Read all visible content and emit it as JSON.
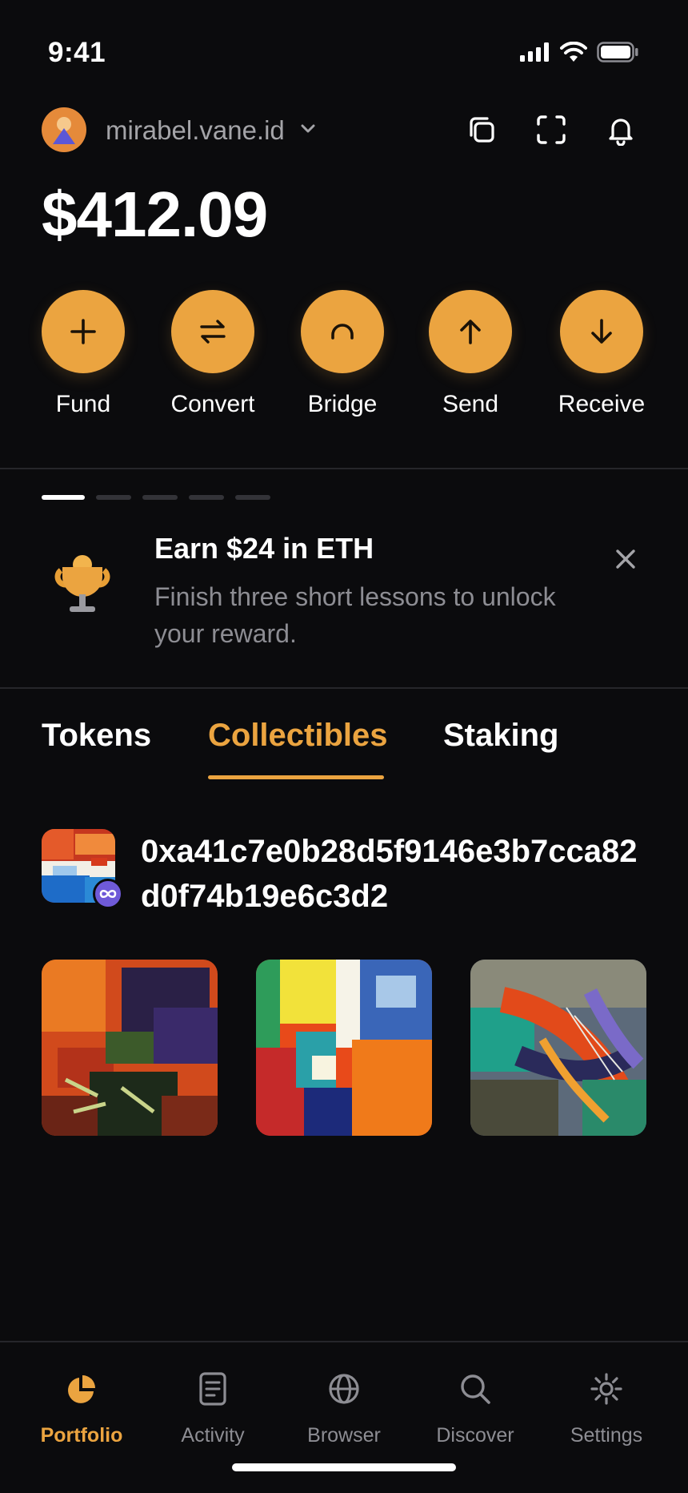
{
  "status_bar": {
    "time": "9:41",
    "icons": [
      "signal-icon",
      "wifi-icon",
      "battery-icon"
    ]
  },
  "header": {
    "account_name": "mirabel.vane.id",
    "icons": [
      "copy-icon",
      "scan-icon",
      "bell-icon"
    ]
  },
  "balance": "$412.09",
  "actions": [
    {
      "label": "Fund",
      "icon": "plus-icon"
    },
    {
      "label": "Convert",
      "icon": "swap-icon"
    },
    {
      "label": "Bridge",
      "icon": "bridge-icon"
    },
    {
      "label": "Send",
      "icon": "arrow-up-icon"
    },
    {
      "label": "Receive",
      "icon": "arrow-down-icon"
    }
  ],
  "promo": {
    "page_count": 5,
    "active_page": 1,
    "title": "Earn $24 in ETH",
    "text": "Finish three short lessons to unlock your reward.",
    "icon": "trophy-icon"
  },
  "tabs": {
    "items": [
      "Tokens",
      "Collectibles",
      "Staking"
    ],
    "active": "Collectibles"
  },
  "collection": {
    "address": "0xa41c7e0b28d5f9146e3b7cca82d0f74b19e6c3d2",
    "badge_icon": "infinity-icon"
  },
  "nfts": [
    "abstract-painting-1",
    "abstract-painting-2",
    "abstract-painting-3"
  ],
  "bottom_nav": {
    "items": [
      {
        "label": "Portfolio",
        "icon": "pie-chart-icon"
      },
      {
        "label": "Activity",
        "icon": "document-icon"
      },
      {
        "label": "Browser",
        "icon": "globe-icon"
      },
      {
        "label": "Discover",
        "icon": "search-icon"
      },
      {
        "label": "Settings",
        "icon": "gear-icon"
      }
    ],
    "active": "Portfolio"
  },
  "colors": {
    "background": "#0b0b0d",
    "accent": "#eba440",
    "muted_text": "#8d8d93"
  }
}
